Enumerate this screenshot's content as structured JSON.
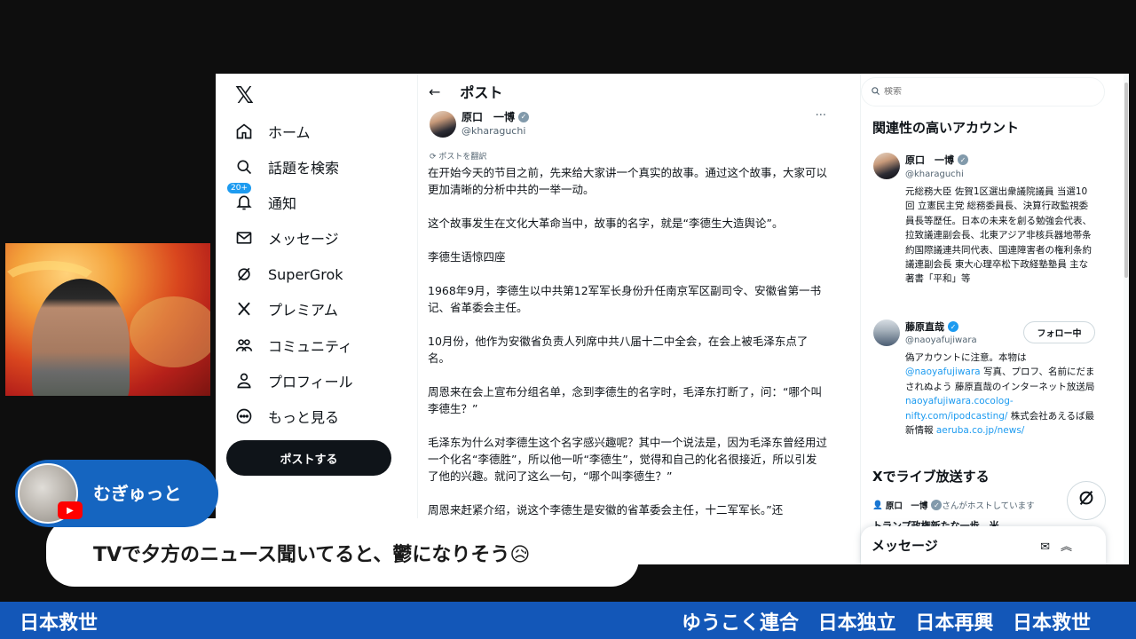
{
  "x_window": {
    "nav": {
      "logo": "𝕏",
      "items": [
        {
          "label": "ホーム",
          "icon": "home-icon"
        },
        {
          "label": "話題を検索",
          "icon": "search-icon"
        },
        {
          "label": "通知",
          "icon": "bell-icon",
          "badge": "20+"
        },
        {
          "label": "メッセージ",
          "icon": "mail-icon"
        },
        {
          "label": "SuperGrok",
          "icon": "grok-icon"
        },
        {
          "label": "プレミアム",
          "icon": "x-icon"
        },
        {
          "label": "コミュニティ",
          "icon": "community-icon"
        },
        {
          "label": "プロフィール",
          "icon": "person-icon"
        },
        {
          "label": "もっと見る",
          "icon": "more-circle-icon"
        }
      ],
      "post_button": "ポストする"
    },
    "post": {
      "header_title": "ポスト",
      "author_name": "原口　一博",
      "author_handle": "@kharaguchi",
      "translate_label": "ポストを翻訳",
      "paragraphs": [
        "在开始今天的节目之前，先来给大家讲一个真实的故事。通过这个故事，大家可以更加清晰的分析中共的一举一动。",
        "这个故事发生在文化大革命当中，故事的名字，就是“李德生大造舆论”。",
        "李德生语惊四座",
        "1968年9月，李德生以中共第12军军长身份升任南京军区副司令、安徽省第一书记、省革委会主任。",
        "10月份，他作为安徽省负责人列席中共八届十二中全会，在会上被毛泽东点了名。",
        "周恩来在会上宣布分组名单，念到李德生的名字时，毛泽东打断了，问：“哪个叫李德生？”",
        "毛泽东为什么对李德生这个名字感兴趣呢？其中一个说法是，因为毛泽东曾经用过一个化名“李德胜”，所以他一听“李德生”，觉得和自己的化名很接近，所以引发了他的兴趣。就问了这么一句，“哪个叫李德生？”",
        "周恩来赶紧介绍，说这个李德生是安徽的省革委会主任，十二军军长。”还"
      ]
    },
    "sidebar": {
      "search_placeholder": "検索",
      "related_title": "関連性の高いアカウント",
      "accounts": [
        {
          "name": "原口　一博",
          "handle": "@kharaguchi",
          "bio": "元総務大臣 佐賀1区選出衆議院議員 当選10回 立憲民主党 総務委員長、決算行政監視委員長等歴任。日本の未来を創る勉強会代表、拉致議連副会長、北東アジア非核兵器地帯条約国際議連共同代表、国連障害者の権利条約議連副会長 東大心理卒松下政経塾塾員 主な著書「平和」等"
        },
        {
          "name": "藤原直哉",
          "handle": "@naoyafujiwara",
          "bio_parts": [
            "偽アカウントに注意。本物は",
            "@naoyafujiwara",
            " 写真、プロフ、名前にだまされぬよう 藤原直哉のインターネット放送局 ",
            "naoyafujiwara.cocolog-nifty.com/ipodcasting/",
            " 株式会社あえるば最新情報 ",
            "aeruba.co.jp/news/"
          ],
          "follow_label": "フォロー中"
        }
      ],
      "live_title": "Xでライブ放送する",
      "live_host_name": "原口　一博",
      "live_host_suffix": "さんがホストしています",
      "live_headline": "トランプ政権新たな一歩、米",
      "messages_label": "メッセージ"
    }
  },
  "overlay": {
    "commenter_name": "むぎゅっと",
    "comment_text": "TVで夕方のニュース聞いてると、鬱になりそう😥"
  },
  "ticker": {
    "left": "日本救世",
    "right": "ゆうこく連合 日本独立 日本再興 日本救世"
  },
  "colors": {
    "accent_blue": "#1d9bf0",
    "overlay_blue": "#1565c0",
    "ticker_blue": "#1357b8",
    "youtube_red": "#ff0000"
  }
}
